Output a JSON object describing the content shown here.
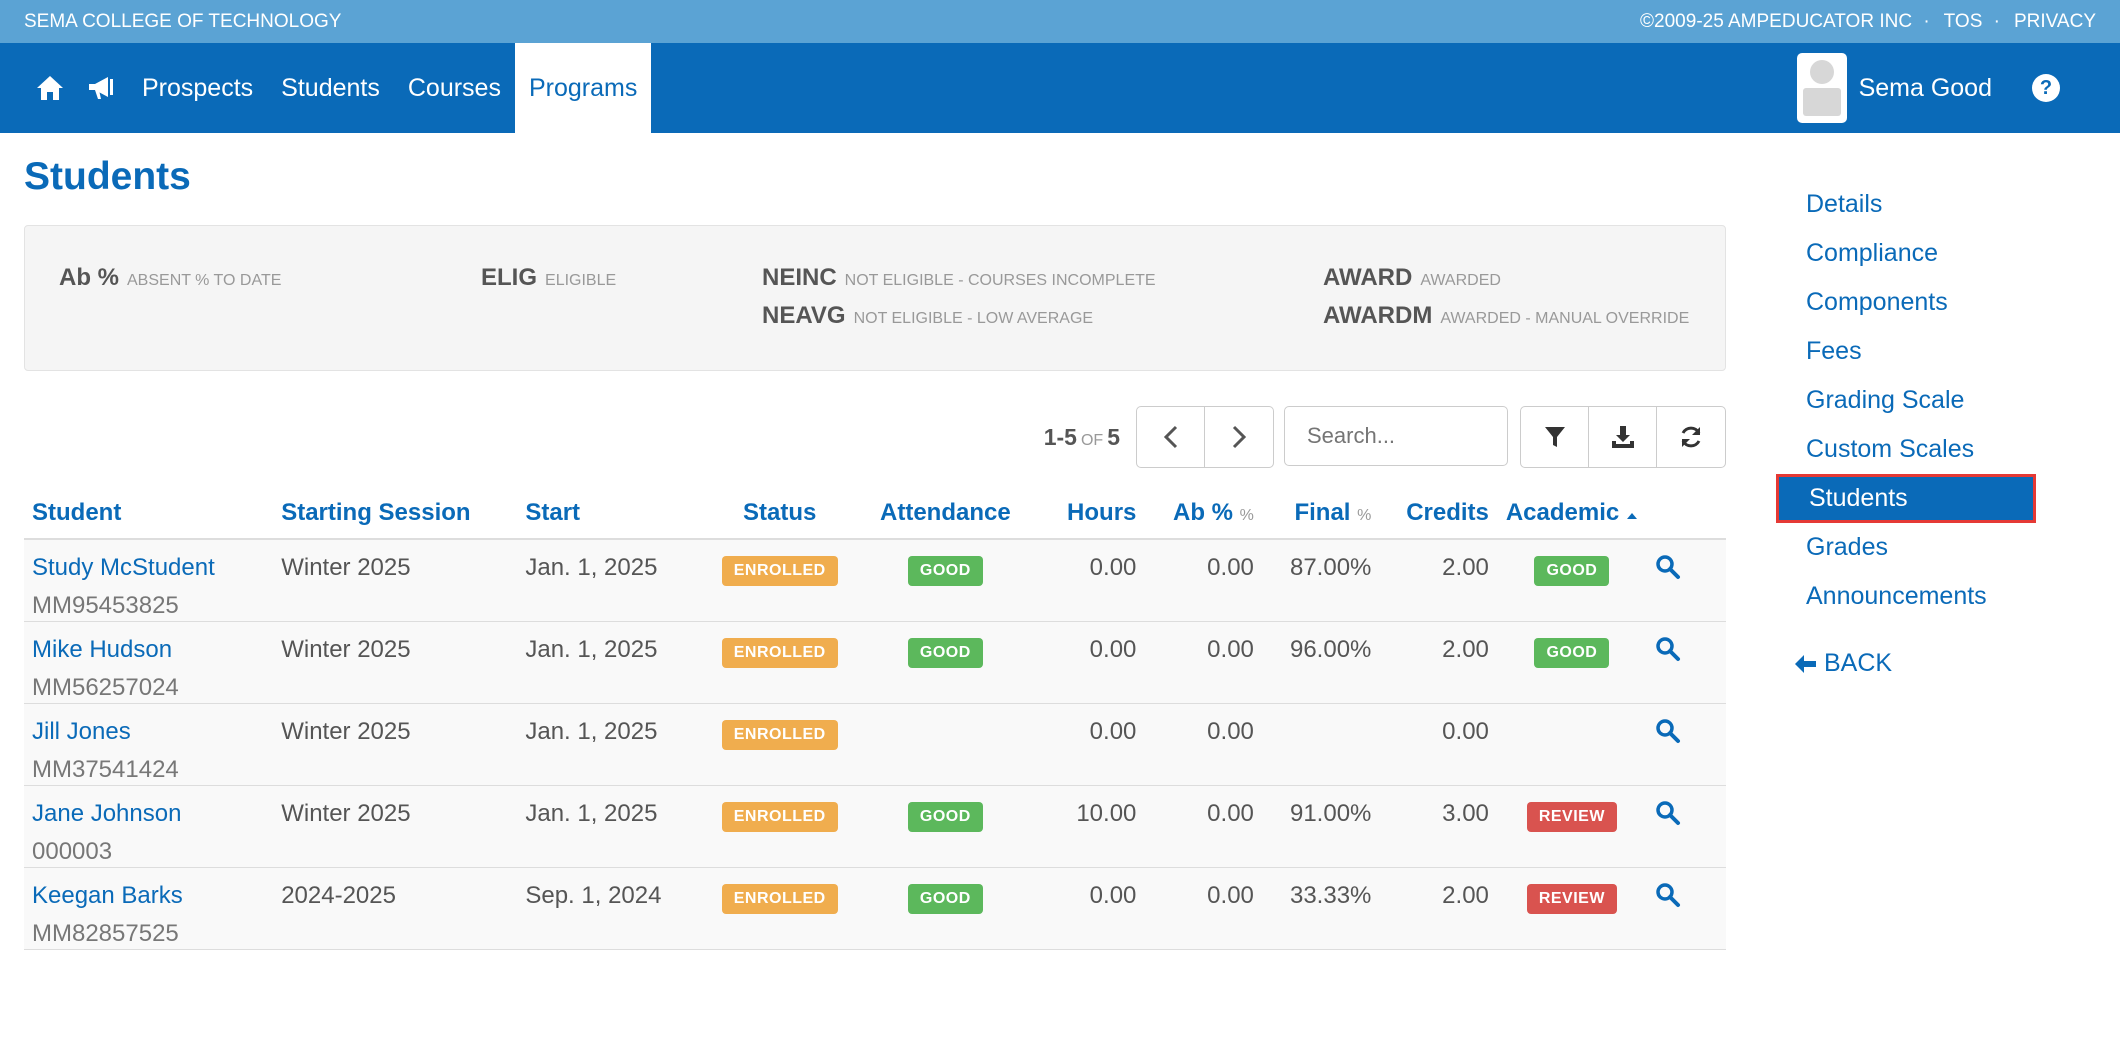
{
  "topbar": {
    "school": "SEMA COLLEGE OF TECHNOLOGY",
    "copyright": "©2009-25 AMPEDUCATOR INC",
    "tos": "TOS",
    "privacy": "PRIVACY",
    "separator": "·"
  },
  "nav": {
    "icons": [
      "home-icon",
      "bullhorn-icon"
    ],
    "links": [
      "Prospects",
      "Students",
      "Courses",
      "Programs"
    ],
    "active": "Programs",
    "user_name": "Sema Good",
    "help": "?"
  },
  "page": {
    "title": "Students"
  },
  "legend": [
    {
      "code": "Ab %",
      "desc": "ABSENT % TO DATE"
    },
    {
      "code": "ELIG",
      "desc": "ELIGIBLE"
    },
    {
      "code": "NEINC",
      "desc": "NOT ELIGIBLE - COURSES INCOMPLETE"
    },
    {
      "code": "NEAVG",
      "desc": "NOT ELIGIBLE - LOW AVERAGE"
    },
    {
      "code": "AWARD",
      "desc": "AWARDED"
    },
    {
      "code": "AWARDM",
      "desc": "AWARDED - MANUAL OVERRIDE"
    }
  ],
  "pager": {
    "range": "1-5",
    "of": "OF",
    "total": "5"
  },
  "search": {
    "placeholder": "Search..."
  },
  "table": {
    "headers": {
      "student": "Student",
      "session": "Starting Session",
      "start": "Start",
      "status": "Status",
      "attendance": "Attendance",
      "hours": "Hours",
      "ab": "Ab %",
      "ab_unit": "%",
      "final": "Final",
      "final_unit": "%",
      "credits": "Credits",
      "academic": "Academic"
    },
    "rows": [
      {
        "name": "Study McStudent",
        "id": "MM95453825",
        "session": "Winter 2025",
        "start": "Jan. 1, 2025",
        "status": "ENROLLED",
        "attendance": "GOOD",
        "hours": "0.00",
        "ab": "0.00",
        "final": "87.00%",
        "credits": "2.00",
        "academic": "GOOD"
      },
      {
        "name": "Mike Hudson",
        "id": "MM56257024",
        "session": "Winter 2025",
        "start": "Jan. 1, 2025",
        "status": "ENROLLED",
        "attendance": "GOOD",
        "hours": "0.00",
        "ab": "0.00",
        "final": "96.00%",
        "credits": "2.00",
        "academic": "GOOD"
      },
      {
        "name": "Jill Jones",
        "id": "MM37541424",
        "session": "Winter 2025",
        "start": "Jan. 1, 2025",
        "status": "ENROLLED",
        "attendance": "",
        "hours": "0.00",
        "ab": "0.00",
        "final": "",
        "credits": "0.00",
        "academic": ""
      },
      {
        "name": "Jane Johnson",
        "id": "000003",
        "session": "Winter 2025",
        "start": "Jan. 1, 2025",
        "status": "ENROLLED",
        "attendance": "GOOD",
        "hours": "10.00",
        "ab": "0.00",
        "final": "91.00%",
        "credits": "3.00",
        "academic": "REVIEW"
      },
      {
        "name": "Keegan Barks",
        "id": "MM82857525",
        "session": "2024-2025",
        "start": "Sep. 1, 2024",
        "status": "ENROLLED",
        "attendance": "GOOD",
        "hours": "0.00",
        "ab": "0.00",
        "final": "33.33%",
        "credits": "2.00",
        "academic": "REVIEW"
      }
    ]
  },
  "sidebar": {
    "items": [
      "Details",
      "Compliance",
      "Components",
      "Fees",
      "Grading Scale",
      "Custom Scales",
      "Students",
      "Grades",
      "Announcements"
    ],
    "active": "Students",
    "back": "BACK"
  },
  "colors": {
    "brand": "#0a6ab8",
    "topbar": "#5ba3d4",
    "enrolled": "#f0ad4e",
    "good": "#5cb85c",
    "review": "#d9534f",
    "highlight": "#e53935"
  }
}
